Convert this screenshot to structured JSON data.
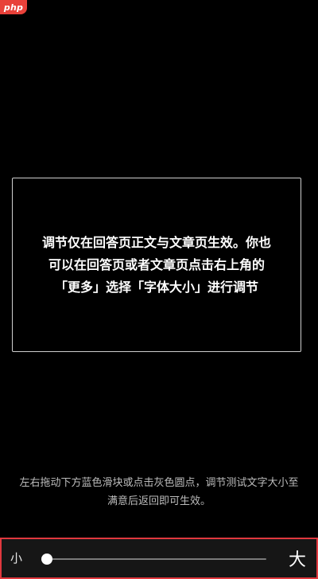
{
  "watermark": {
    "text": "php"
  },
  "preview": {
    "text": "调节仅在回答页正文与文章页生效。你也可以在回答页或者文章页点击右上角的「更多」选择「字体大小」进行调节"
  },
  "hint": {
    "text": "左右拖动下方蓝色滑块或点击灰色圆点，调节测试文字大小至满意后返回即可生效。"
  },
  "font_size_slider": {
    "min_label": "小",
    "max_label": "大",
    "level_fraction": 0.0
  },
  "colors": {
    "background": "#000000",
    "highlight_border": "#e0383e",
    "watermark": "#e8413a"
  }
}
